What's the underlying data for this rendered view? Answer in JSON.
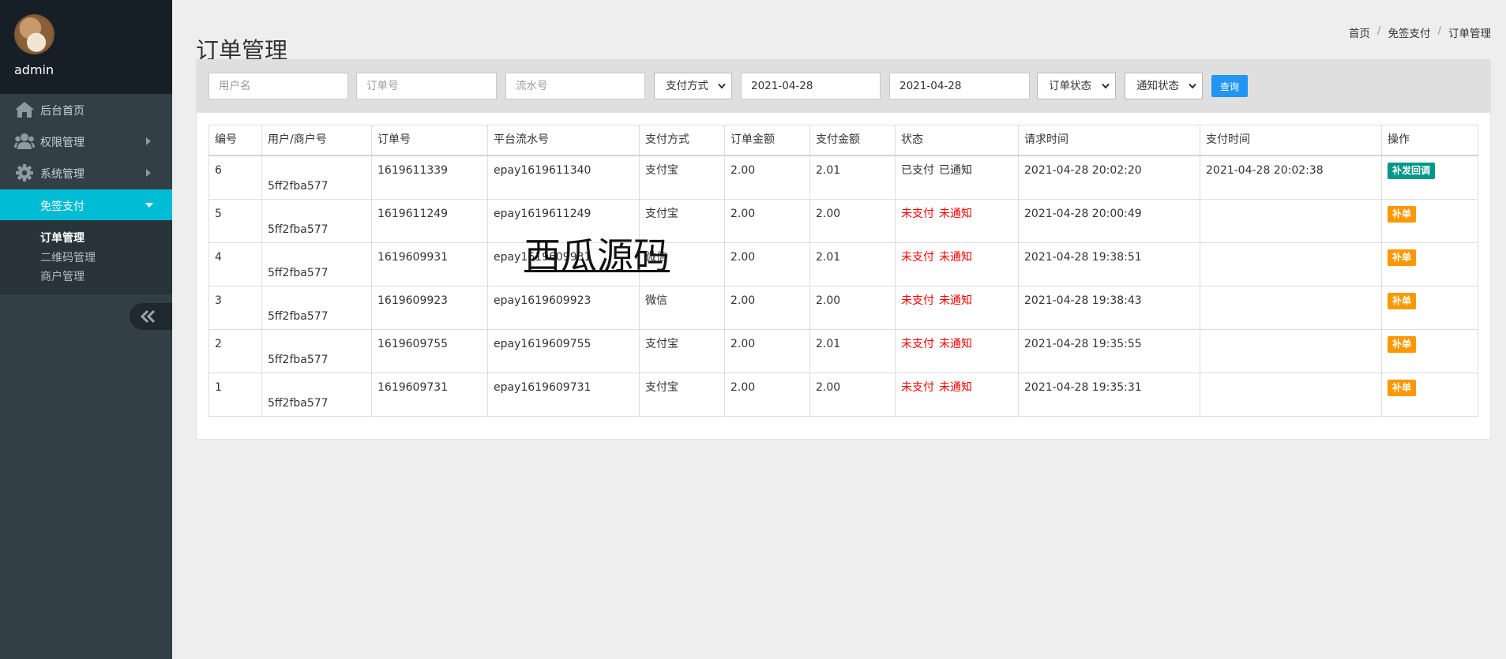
{
  "sidebar": {
    "username": "admin",
    "menu": [
      {
        "label": "后台首页",
        "icon": "home-icon"
      },
      {
        "label": "权限管理",
        "icon": "users-icon"
      },
      {
        "label": "系统管理",
        "icon": "gear-icon"
      },
      {
        "label": "免签支付",
        "icon": "",
        "active": true
      }
    ],
    "submenu": [
      {
        "label": "订单管理",
        "active": true
      },
      {
        "label": "二维码管理"
      },
      {
        "label": "商户管理"
      }
    ],
    "collapse_icon": "double-chevron-left-icon"
  },
  "page": {
    "title": "订单管理",
    "breadcrumb": [
      "首页",
      "免签支付",
      "订单管理"
    ],
    "separator": "/"
  },
  "filters": {
    "username_placeholder": "用户名",
    "order_no_placeholder": "订单号",
    "serial_no_placeholder": "流水号",
    "pay_method": "支付方式",
    "start_date": "2021-04-28",
    "end_date": "2021-04-28",
    "order_status": "订单状态",
    "notify_status": "通知状态",
    "search_label": "查询"
  },
  "table": {
    "headers": [
      "编号",
      "用户/商户号",
      "订单号",
      "平台流水号",
      "支付方式",
      "订单金额",
      "支付金额",
      "状态",
      "请求时间",
      "支付时间",
      "操作"
    ],
    "rows": [
      {
        "id": "6",
        "merchant": "5ff2fba577",
        "order_no": "1619611339",
        "serial_no": "epay1619611340",
        "pay_method": "支付宝",
        "order_amount": "2.00",
        "paid_amount": "2.01",
        "pay_status": "已支付",
        "notify_status": "已通知",
        "status_color": "#333333",
        "request_time": "2021-04-28 20:02:20",
        "pay_time": "2021-04-28 20:02:38",
        "action": "补发回调",
        "action_color": "#009688"
      },
      {
        "id": "5",
        "merchant": "5ff2fba577",
        "order_no": "1619611249",
        "serial_no": "epay1619611249",
        "pay_method": "支付宝",
        "order_amount": "2.00",
        "paid_amount": "2.00",
        "pay_status": "未支付",
        "notify_status": "未通知",
        "status_color": "#ff0000",
        "request_time": "2021-04-28 20:00:49",
        "pay_time": "",
        "action": "补单",
        "action_color": "#ff9800"
      },
      {
        "id": "4",
        "merchant": "5ff2fba577",
        "order_no": "1619609931",
        "serial_no": "epay1619609931",
        "pay_method": "微信",
        "order_amount": "2.00",
        "paid_amount": "2.01",
        "pay_status": "未支付",
        "notify_status": "未通知",
        "status_color": "#ff0000",
        "request_time": "2021-04-28 19:38:51",
        "pay_time": "",
        "action": "补单",
        "action_color": "#ff9800"
      },
      {
        "id": "3",
        "merchant": "5ff2fba577",
        "order_no": "1619609923",
        "serial_no": "epay1619609923",
        "pay_method": "微信",
        "order_amount": "2.00",
        "paid_amount": "2.00",
        "pay_status": "未支付",
        "notify_status": "未通知",
        "status_color": "#ff0000",
        "request_time": "2021-04-28 19:38:43",
        "pay_time": "",
        "action": "补单",
        "action_color": "#ff9800"
      },
      {
        "id": "2",
        "merchant": "5ff2fba577",
        "order_no": "1619609755",
        "serial_no": "epay1619609755",
        "pay_method": "支付宝",
        "order_amount": "2.00",
        "paid_amount": "2.01",
        "pay_status": "未支付",
        "notify_status": "未通知",
        "status_color": "#ff0000",
        "request_time": "2021-04-28 19:35:55",
        "pay_time": "",
        "action": "补单",
        "action_color": "#ff9800"
      },
      {
        "id": "1",
        "merchant": "5ff2fba577",
        "order_no": "1619609731",
        "serial_no": "epay1619609731",
        "pay_method": "支付宝",
        "order_amount": "2.00",
        "paid_amount": "2.00",
        "pay_status": "未支付",
        "notify_status": "未通知",
        "status_color": "#ff0000",
        "request_time": "2021-04-28 19:35:31",
        "pay_time": "",
        "action": "补单",
        "action_color": "#ff9800"
      }
    ]
  },
  "watermark": "西瓜源码",
  "colors": {
    "accent": "#00bcd4",
    "primary_button": "#2196f3",
    "success_button": "#009688",
    "warning_button": "#ff9800",
    "status_unpaid": "#ff0000"
  }
}
